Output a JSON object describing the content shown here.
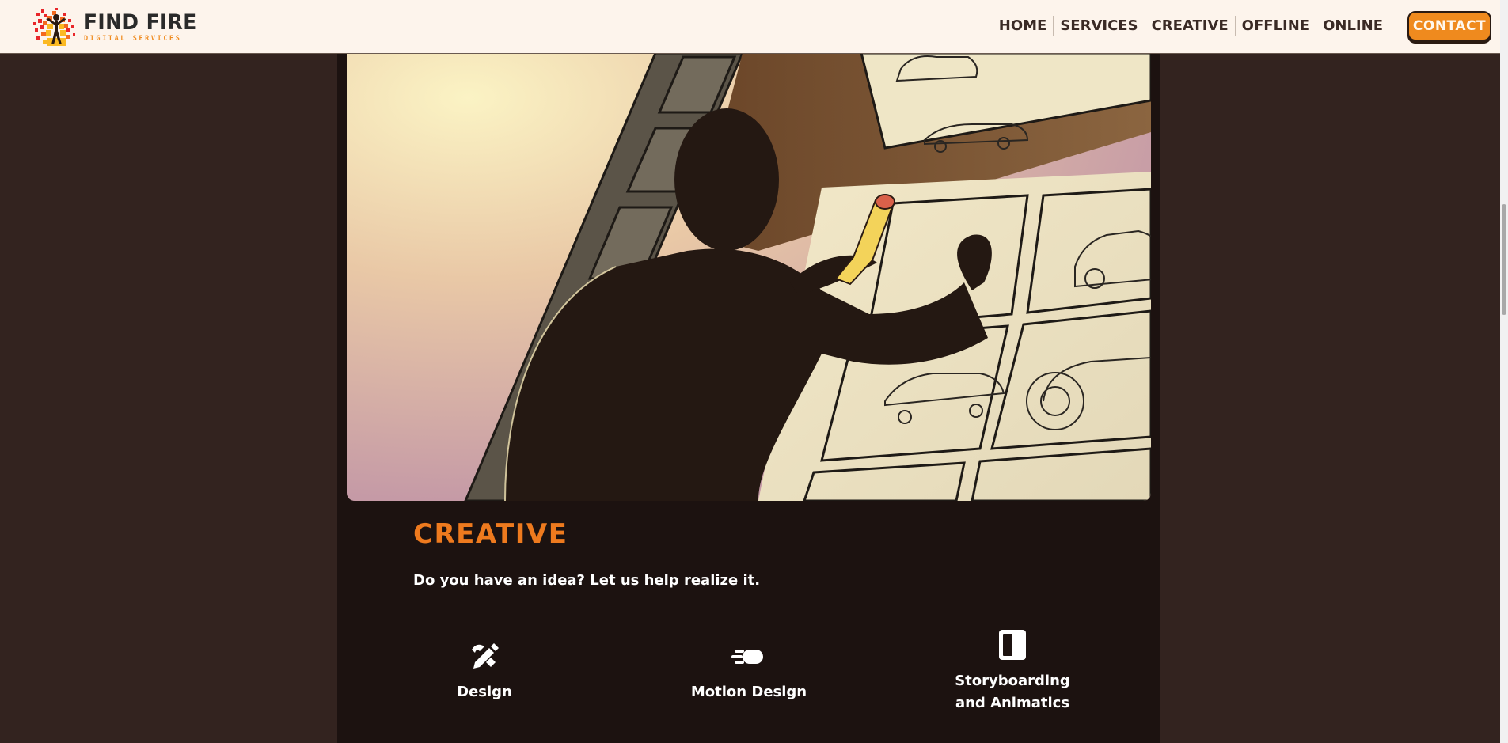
{
  "brand": {
    "title": "FIND FIRE",
    "subtitle": "DIGITAL SERVICES",
    "accent_color": "#ef8a1e"
  },
  "nav": {
    "links": [
      "HOME",
      "SERVICES",
      "CREATIVE",
      "OFFLINE",
      "ONLINE"
    ],
    "contact_label": "CONTACT"
  },
  "hero": {
    "image": "illustration of a silhouetted artist drawing car storyboard sketches on a wall"
  },
  "section": {
    "title": "CREATIVE",
    "subtitle": "Do you have an idea? Let us help realize it."
  },
  "services": [
    {
      "label": "Design",
      "icon": "pen-ruler-icon"
    },
    {
      "label": "Motion Design",
      "icon": "motion-icon"
    },
    {
      "label_line1": "Storyboarding",
      "label_line2": "and Animatics",
      "icon": "storyboard-panel-icon"
    }
  ],
  "colors": {
    "page_bg": "#33231f",
    "content_bg": "#1c1210",
    "title_orange": "#ee7a1e",
    "nav_bg": "#fdf4ec"
  }
}
